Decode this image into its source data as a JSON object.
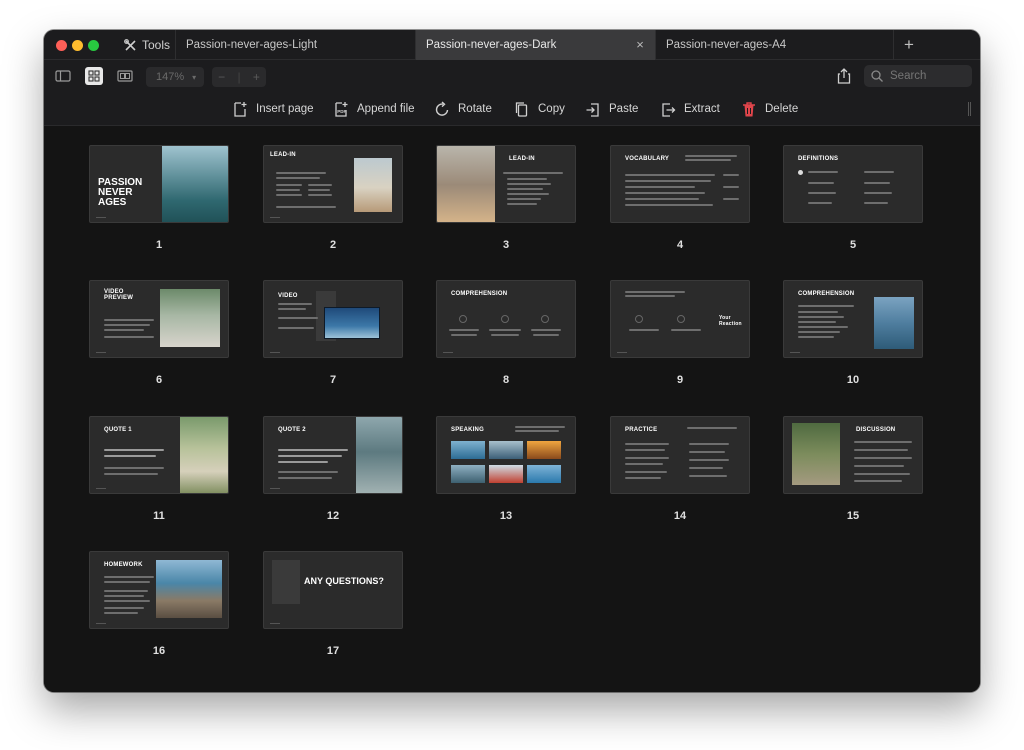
{
  "tabs": {
    "tools_label": "Tools",
    "items": [
      {
        "label": "Passion-never-ages-Light",
        "active": false
      },
      {
        "label": "Passion-never-ages-Dark",
        "active": true
      },
      {
        "label": "Passion-never-ages-A4",
        "active": false
      }
    ],
    "close_symbol": "×",
    "add_symbol": "+"
  },
  "toolbar": {
    "zoom_value": "147%",
    "zoom_minus": "−",
    "zoom_plus": "+",
    "search_placeholder": "Search"
  },
  "actions": [
    {
      "label": "Insert page",
      "icon": "insert-page-icon"
    },
    {
      "label": "Append file",
      "icon": "append-file-icon"
    },
    {
      "label": "Rotate",
      "icon": "rotate-icon"
    },
    {
      "label": "Copy",
      "icon": "copy-icon"
    },
    {
      "label": "Paste",
      "icon": "paste-icon"
    },
    {
      "label": "Extract",
      "icon": "extract-icon"
    },
    {
      "label": "Delete",
      "icon": "delete-icon"
    }
  ],
  "colors": {
    "accent_delete": "#e0454b",
    "window_bg": "#141414",
    "active_tab": "#3a3a3c"
  },
  "pages": [
    {
      "number": "1",
      "title": "PASSION NEVER AGES"
    },
    {
      "number": "2",
      "title": "LEAD-IN"
    },
    {
      "number": "3",
      "title": "LEAD-IN"
    },
    {
      "number": "4",
      "title": "VOCABULARY"
    },
    {
      "number": "5",
      "title": "DEFINITIONS"
    },
    {
      "number": "6",
      "title": "VIDEO PREVIEW"
    },
    {
      "number": "7",
      "title": "VIDEO"
    },
    {
      "number": "8",
      "title": "COMPREHENSION"
    },
    {
      "number": "9",
      "title": "Your Reaction"
    },
    {
      "number": "10",
      "title": "COMPREHENSION"
    },
    {
      "number": "11",
      "title": "QUOTE 1"
    },
    {
      "number": "12",
      "title": "QUOTE 2"
    },
    {
      "number": "13",
      "title": "SPEAKING"
    },
    {
      "number": "14",
      "title": "PRACTICE"
    },
    {
      "number": "15",
      "title": "DISCUSSION"
    },
    {
      "number": "16",
      "title": "HOMEWORK"
    },
    {
      "number": "17",
      "title": "ANY QUESTIONS?"
    }
  ]
}
